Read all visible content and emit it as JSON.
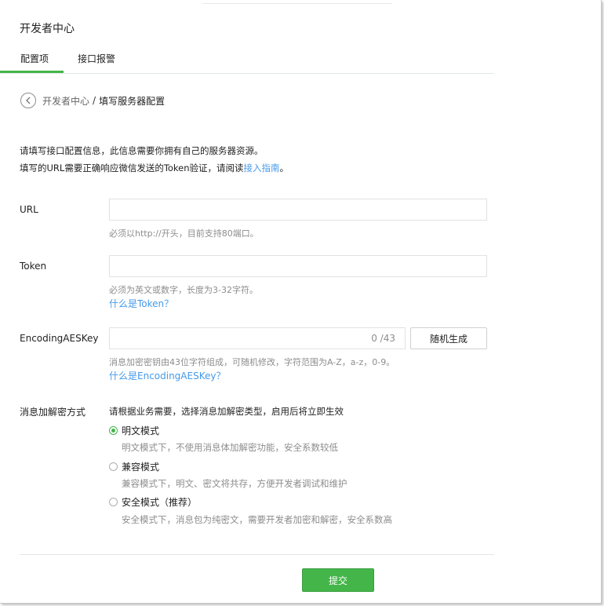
{
  "header": {
    "title": "开发者中心"
  },
  "tabs": [
    {
      "label": "配置项",
      "active": true
    },
    {
      "label": "接口报警",
      "active": false
    }
  ],
  "breadcrumb": {
    "parent": "开发者中心",
    "separator": "/",
    "current": "填写服务器配置"
  },
  "intro": {
    "line1": "请填写接口配置信息，此信息需要你拥有自己的服务器资源。",
    "line2_prefix": "填写的URL需要正确响应微信发送的Token验证，请阅读",
    "line2_link": "接入指南",
    "line2_suffix": "。"
  },
  "form": {
    "url": {
      "label": "URL",
      "value": "",
      "placeholder": "",
      "hint": "必须以http://开头，目前支持80端口。"
    },
    "token": {
      "label": "Token",
      "value": "",
      "placeholder": "",
      "hint": "必须为英文或数字，长度为3-32字符。",
      "help_link": "什么是Token？"
    },
    "aeskey": {
      "label": "EncodingAESKey",
      "value": "",
      "placeholder": "",
      "counter": "0 /43",
      "random_button": "随机生成",
      "hint": "消息加密密钥由43位字符组成，可随机修改，字符范围为A-Z，a-z，0-9。",
      "help_link": "什么是EncodingAESKey？"
    },
    "encryption": {
      "label": "消息加解密方式",
      "description": "请根据业务需要，选择消息加解密类型，启用后将立即生效",
      "options": [
        {
          "label": "明文模式",
          "desc": "明文模式下，不使用消息体加解密功能，安全系数较低",
          "checked": true
        },
        {
          "label": "兼容模式",
          "desc": "兼容模式下，明文、密文将共存，方便开发者调试和维护",
          "checked": false
        },
        {
          "label": "安全模式（推荐）",
          "desc": "安全模式下，消息包为纯密文，需要开发者加密和解密，安全系数高",
          "checked": false
        }
      ]
    },
    "submit_label": "提交"
  },
  "colors": {
    "accent": "#44b549",
    "link": "#459ae9",
    "hint": "#8d8d8d"
  }
}
